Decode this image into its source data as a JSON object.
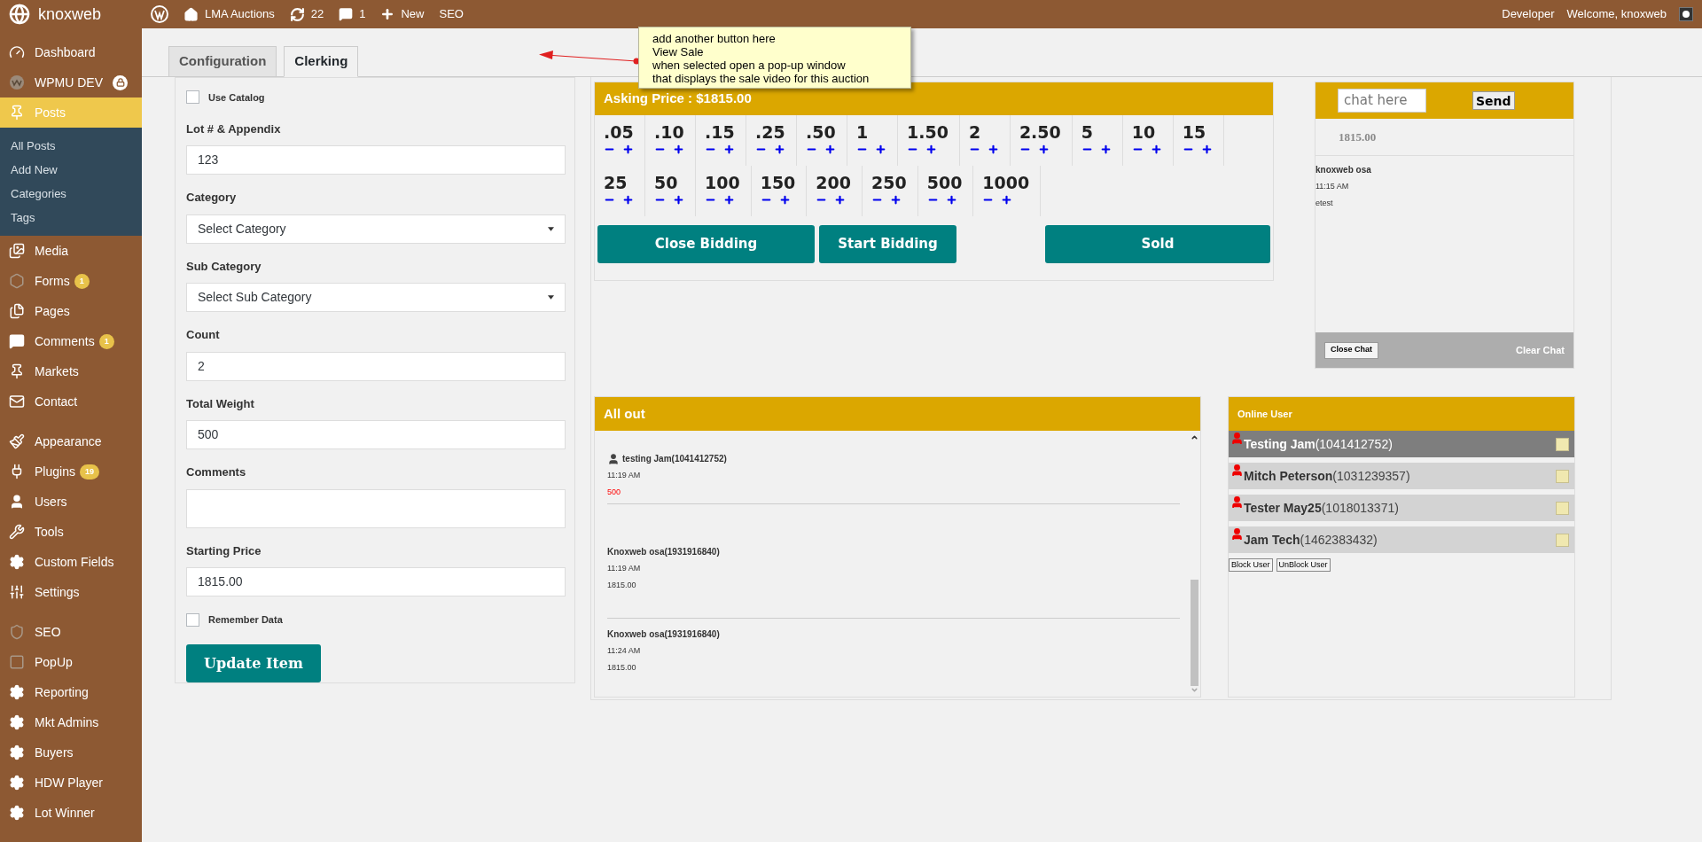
{
  "topbar": {
    "site": "knoxweb",
    "items": [
      {
        "kind": "wp"
      },
      {
        "kind": "home",
        "label": "LMA Auctions"
      },
      {
        "kind": "updates",
        "label": "22"
      },
      {
        "kind": "comments",
        "label": "1"
      },
      {
        "kind": "new",
        "label": "New"
      },
      {
        "kind": "text",
        "label": "SEO"
      }
    ],
    "right": [
      "Developer",
      "Welcome, knoxweb"
    ]
  },
  "sidebar": {
    "groups": [
      [
        {
          "label": "Dashboard",
          "selected": false
        },
        {
          "label": "WPMU DEV",
          "selected": false,
          "locked": true
        },
        {
          "label": "Posts",
          "selected": true,
          "children": [
            {
              "label": "All Posts"
            },
            {
              "label": "Add New"
            },
            {
              "label": "Categories"
            },
            {
              "label": "Tags"
            }
          ]
        },
        {
          "label": "Media",
          "selected": false
        },
        {
          "label": "Forms",
          "selected": false,
          "badge": "1"
        },
        {
          "label": "Pages",
          "selected": false
        },
        {
          "label": "Comments",
          "selected": false,
          "badge": "1"
        },
        {
          "label": "Markets",
          "selected": false
        },
        {
          "label": "Contact",
          "selected": false
        }
      ],
      [
        {
          "label": "Appearance",
          "selected": false
        },
        {
          "label": "Plugins",
          "selected": false,
          "badge": "19"
        },
        {
          "label": "Users",
          "selected": false
        },
        {
          "label": "Tools",
          "selected": false
        },
        {
          "label": "Custom Fields",
          "selected": false
        },
        {
          "label": "Settings",
          "selected": false
        }
      ],
      [
        {
          "label": "SEO",
          "selected": false
        },
        {
          "label": "PopUp",
          "selected": false
        },
        {
          "label": "Reporting",
          "selected": false
        },
        {
          "label": "Mkt Admins",
          "selected": false
        },
        {
          "label": "Buyers",
          "selected": false
        },
        {
          "label": "HDW Player",
          "selected": false
        },
        {
          "label": "Lot Winner",
          "selected": false
        }
      ]
    ]
  },
  "tabs": [
    {
      "label": "Configuration",
      "selected": false
    },
    {
      "label": "Clerking",
      "selected": true
    }
  ],
  "form": {
    "fields": [
      {
        "kind": "checkbox",
        "label": "Use Catalog",
        "checked": false
      },
      {
        "kind": "text",
        "label": "Lot # & Appendix",
        "value": "123"
      },
      {
        "kind": "select",
        "label": "Category",
        "value": "Select Category"
      },
      {
        "kind": "select",
        "label": "Sub Category",
        "value": "Select Sub Category"
      },
      {
        "kind": "text",
        "label": "Count",
        "value": "2"
      },
      {
        "kind": "text",
        "label": "Total Weight",
        "value": "500"
      },
      {
        "kind": "textarea",
        "label": "Comments"
      },
      {
        "kind": "text",
        "label": "Starting Price",
        "value": "1815.00"
      },
      {
        "kind": "checkbox",
        "label": "Remember Data",
        "checked": false
      }
    ],
    "button": "Update Item"
  },
  "bidding": {
    "title": "Asking Price : $1815.00",
    "increments": [
      ".05",
      ".10",
      ".15",
      ".25",
      ".50",
      "1",
      "1.50",
      "2",
      "2.50",
      "5",
      "10",
      "15",
      "25",
      "50",
      "100",
      "150",
      "200",
      "250",
      "500",
      "1000"
    ],
    "buttons": [
      "Close Bidding",
      "Start Bidding",
      "Sold"
    ]
  },
  "chat": {
    "placeholder": "chat here",
    "send": "Send",
    "price": "1815.00",
    "messages": [
      {
        "user": "knoxweb osa",
        "time": "11:15 AM",
        "text": "etest"
      }
    ],
    "close": "Close Chat",
    "clear": "Clear Chat"
  },
  "all_out": {
    "title": "All out",
    "entries": [
      {
        "kind": "user",
        "name": "testing Jam(1041412752)",
        "time": "11:19 AM",
        "amount": "500"
      },
      {
        "kind": "clerk",
        "name": "Knoxweb osa(1931916840)",
        "time": "11:19 AM",
        "amount": "1815.00"
      },
      {
        "kind": "clerk",
        "name": "Knoxweb osa(1931916840)",
        "time": "11:24 AM",
        "amount": "1815.00"
      }
    ]
  },
  "online": {
    "title": "Online User",
    "users": [
      {
        "name": "Testing Jam",
        "id": "(1041412752)",
        "selected": true,
        "checked": false
      },
      {
        "name": "Mitch Peterson",
        "id": "(1031239357)",
        "selected": false,
        "checked": false
      },
      {
        "name": "Tester May25",
        "id": "(1018013371)",
        "selected": false,
        "checked": false
      },
      {
        "name": "Jam Tech",
        "id": "(1462383432)",
        "selected": false,
        "checked": false
      }
    ],
    "buttons": [
      "Block User",
      "UnBlock User"
    ]
  },
  "note": {
    "lines": [
      "add another button here",
      "View Sale",
      "when selected open a pop-up window",
      "that displays the sale video for this auction"
    ]
  }
}
